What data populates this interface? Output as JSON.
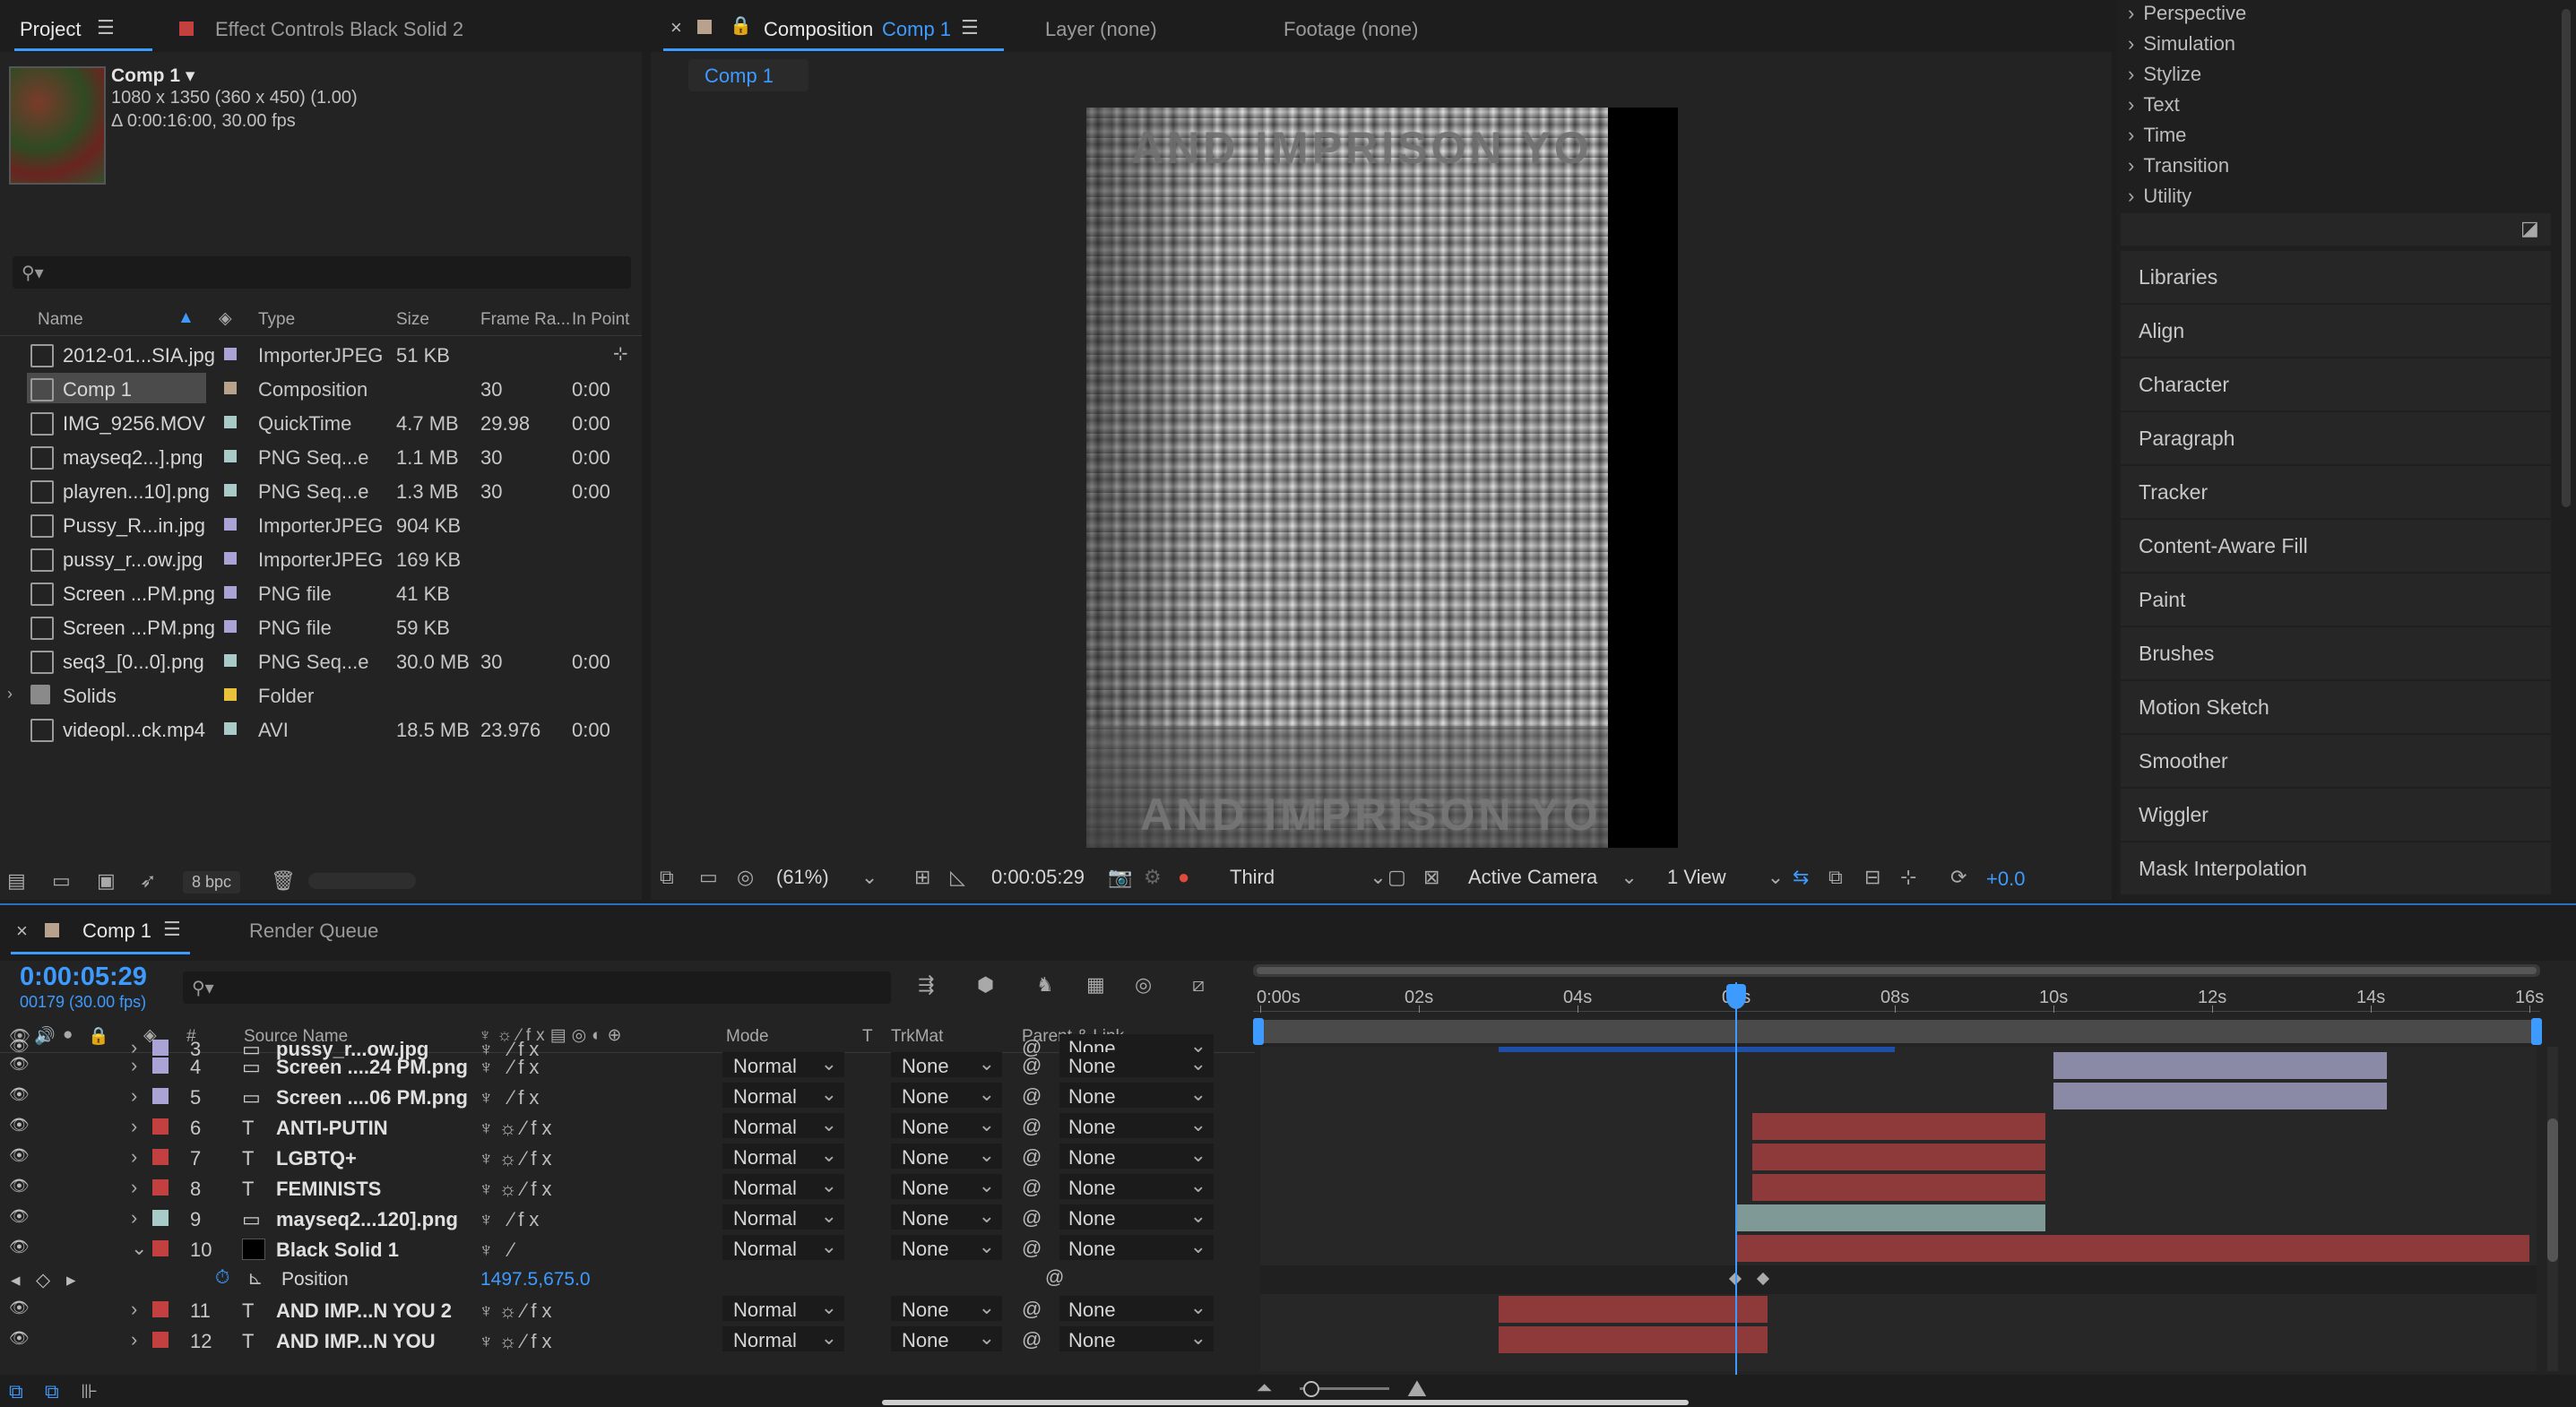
{
  "project_panel": {
    "tab_project": "Project",
    "tab_effect_controls": "Effect Controls Black Solid 2",
    "comp_name": "Comp 1 ▾",
    "comp_info_1": "1080 x 1350  (360 x 450) (1.00)",
    "comp_info_2": "Δ 0:00:16:00, 30.00 fps",
    "search_placeholder": "",
    "columns": [
      "Name",
      "Type",
      "Size",
      "Frame Ra...",
      "In Point"
    ],
    "items": [
      {
        "name": "2012-01...SIA.jpg",
        "type": "ImporterJPEG",
        "size": "51 KB",
        "fps": "",
        "in": "",
        "label": "#a9a3d6"
      },
      {
        "name": "Comp 1",
        "type": "Composition",
        "size": "",
        "fps": "30",
        "in": "0:00",
        "label": "#b8a28e"
      },
      {
        "name": "IMG_9256.MOV",
        "type": "QuickTime",
        "size": "4.7 MB",
        "fps": "29.98",
        "in": "0:00",
        "label": "#a9cbc8"
      },
      {
        "name": "mayseq2...].png",
        "type": "PNG Seq...e",
        "size": "1.1 MB",
        "fps": "30",
        "in": "0:00",
        "label": "#a9cbc8"
      },
      {
        "name": "playren...10].png",
        "type": "PNG Seq...e",
        "size": "1.3 MB",
        "fps": "30",
        "in": "0:00",
        "label": "#a9cbc8"
      },
      {
        "name": "Pussy_R...in.jpg",
        "type": "ImporterJPEG",
        "size": "904 KB",
        "fps": "",
        "in": "",
        "label": "#a9a3d6"
      },
      {
        "name": "pussy_r...ow.jpg",
        "type": "ImporterJPEG",
        "size": "169 KB",
        "fps": "",
        "in": "",
        "label": "#a9a3d6"
      },
      {
        "name": "Screen ...PM.png",
        "type": "PNG file",
        "size": "41 KB",
        "fps": "",
        "in": "",
        "label": "#a9a3d6"
      },
      {
        "name": "Screen ...PM.png",
        "type": "PNG file",
        "size": "59 KB",
        "fps": "",
        "in": "",
        "label": "#a9a3d6"
      },
      {
        "name": "seq3_[0...0].png",
        "type": "PNG Seq...e",
        "size": "30.0 MB",
        "fps": "30",
        "in": "0:00",
        "label": "#a9cbc8"
      },
      {
        "name": "Solids",
        "type": "Folder",
        "size": "",
        "fps": "",
        "in": "",
        "label": "#e8c23a"
      },
      {
        "name": "videopl...ck.mp4",
        "type": "AVI",
        "size": "18.5 MB",
        "fps": "23.976",
        "in": "0:00",
        "label": "#a9cbc8"
      }
    ],
    "bpc": "8 bpc"
  },
  "comp_panel": {
    "tab_composition": "Composition",
    "tab_comp_name": "Comp 1",
    "tab_layer": "Layer (none)",
    "tab_footage": "Footage (none)",
    "breadcrumb": "Comp 1",
    "viewer_text_top": "AND IMPRISON YO",
    "viewer_text_bottom": "AND IMPRISON YO",
    "zoom": "(61%)",
    "timecode": "0:00:05:29",
    "resolution": "Third",
    "camera": "Active Camera",
    "views": "1 View",
    "exposure": "+0.0"
  },
  "effects_panel": {
    "categories": [
      "Perspective",
      "Simulation",
      "Stylize",
      "Text",
      "Time",
      "Transition",
      "Utility"
    ],
    "panels": [
      "Libraries",
      "Align",
      "Character",
      "Paragraph",
      "Tracker",
      "Content-Aware Fill",
      "Paint",
      "Brushes",
      "Motion Sketch",
      "Smoother",
      "Wiggler",
      "Mask Interpolation"
    ]
  },
  "timeline": {
    "tab_comp": "Comp 1",
    "tab_render": "Render Queue",
    "timecode": "0:00:05:29",
    "frame_info": "00179 (30.00 fps)",
    "columns": {
      "num": "#",
      "source": "Source Name",
      "mode": "Mode",
      "t": "T",
      "trkmat": "TrkMat",
      "parent": "Parent & Link"
    },
    "ruler": [
      "0:00s",
      "02s",
      "04s",
      "06s",
      "08s",
      "10s",
      "12s",
      "14s",
      "16s"
    ],
    "layers": [
      {
        "num": "3",
        "name": "pussy_r...ow.jpg",
        "type": "img",
        "label": "#a9a3d6",
        "mode": "",
        "trk": "",
        "parent": "None",
        "partial": true
      },
      {
        "num": "4",
        "name": "Screen ....24 PM.png",
        "type": "img",
        "label": "#a9a3d6",
        "mode": "Normal",
        "trk": "None",
        "parent": "None"
      },
      {
        "num": "5",
        "name": "Screen ....06 PM.png",
        "type": "img",
        "label": "#a9a3d6",
        "mode": "Normal",
        "trk": "None",
        "parent": "None"
      },
      {
        "num": "6",
        "name": "ANTI-PUTIN",
        "type": "text",
        "label": "#c24040",
        "mode": "Normal",
        "trk": "None",
        "parent": "None"
      },
      {
        "num": "7",
        "name": "LGBTQ+",
        "type": "text",
        "label": "#c24040",
        "mode": "Normal",
        "trk": "None",
        "parent": "None"
      },
      {
        "num": "8",
        "name": "FEMINISTS",
        "type": "text",
        "label": "#c24040",
        "mode": "Normal",
        "trk": "None",
        "parent": "None"
      },
      {
        "num": "9",
        "name": "mayseq2...120].png",
        "type": "seq",
        "label": "#a9cbc8",
        "mode": "Normal",
        "trk": "None",
        "parent": "None"
      },
      {
        "num": "10",
        "name": "Black Solid 1",
        "type": "solid",
        "label": "#c24040",
        "mode": "Normal",
        "trk": "None",
        "parent": "None"
      },
      {
        "num": "11",
        "name": "AND IMP...N YOU 2",
        "type": "text",
        "label": "#c24040",
        "mode": "Normal",
        "trk": "None",
        "parent": "None"
      },
      {
        "num": "12",
        "name": "AND IMP...N YOU",
        "type": "text",
        "label": "#c24040",
        "mode": "Normal",
        "trk": "None",
        "parent": "None"
      }
    ],
    "position_label": "Position",
    "position_value": "1497.5,675.0",
    "playhead_seconds": 6.0
  }
}
